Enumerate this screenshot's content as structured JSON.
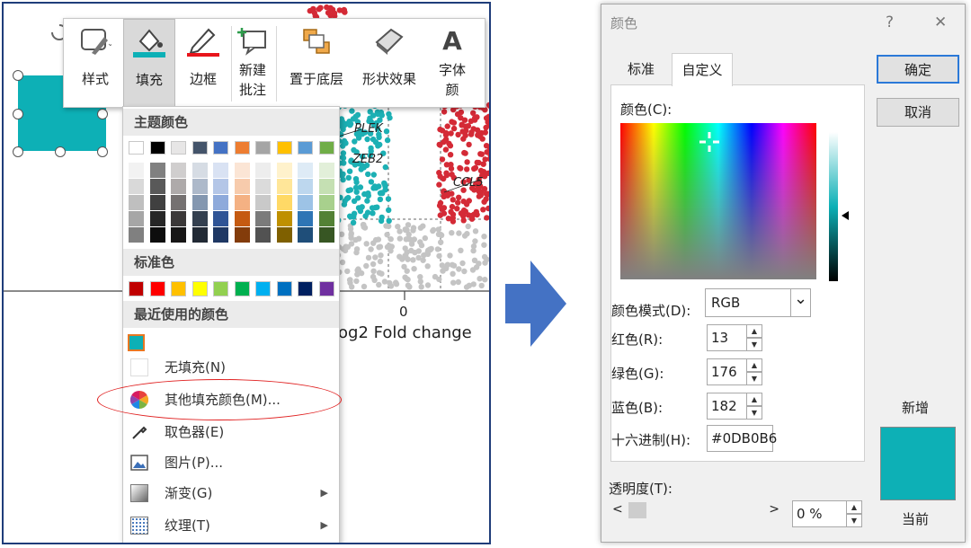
{
  "left_panel": {
    "background_chart": {
      "gene_labels": [
        "PLEK",
        "ZEB2",
        "CCL5"
      ],
      "axis_tick": "0",
      "axis_label": "og2 Fold change"
    },
    "shape_color": "#0DB0B6",
    "toolbar": {
      "items": [
        {
          "label": "样式",
          "icon": "style-shape-icon"
        },
        {
          "label": "填充",
          "icon": "paint-bucket-icon"
        },
        {
          "label": "边框",
          "icon": "pen-border-icon"
        },
        {
          "label": "新建\n批注",
          "icon": "new-comment-icon"
        },
        {
          "label": "置于底层",
          "icon": "send-to-back-icon"
        },
        {
          "label": "形状效果",
          "icon": "shape-effects-icon"
        },
        {
          "label": "字体\n颜",
          "icon": "font-color-icon"
        }
      ],
      "font_icon_glyph": "A"
    },
    "fill_menu": {
      "theme_colors_header": "主题颜色",
      "theme_colors_top": [
        "#FFFFFF",
        "#000000",
        "#E7E6E6",
        "#44546A",
        "#4472C4",
        "#ED7D31",
        "#A5A5A5",
        "#FFC000",
        "#5B9BD5",
        "#70AD47"
      ],
      "theme_tints": [
        [
          "#F2F2F2",
          "#D9D9D9",
          "#BFBFBF",
          "#A6A6A6",
          "#808080"
        ],
        [
          "#808080",
          "#595959",
          "#404040",
          "#262626",
          "#0D0D0D"
        ],
        [
          "#D0CECE",
          "#AEAAAA",
          "#757171",
          "#3B3838",
          "#171616"
        ],
        [
          "#D6DCE4",
          "#ADB9CA",
          "#8497B0",
          "#333F4F",
          "#222A35"
        ],
        [
          "#D9E2F3",
          "#B4C6E7",
          "#8EAADB",
          "#2F5496",
          "#1F3864"
        ],
        [
          "#FBE5D5",
          "#F7CBAC",
          "#F4B183",
          "#C55A11",
          "#833C0B"
        ],
        [
          "#EDEDED",
          "#DBDBDB",
          "#C9C9C9",
          "#7B7B7B",
          "#525252"
        ],
        [
          "#FFF2CC",
          "#FFE699",
          "#FFD966",
          "#BF9000",
          "#7F6000"
        ],
        [
          "#DEEBF6",
          "#BDD7EE",
          "#9DC3E6",
          "#2E75B5",
          "#1F4E79"
        ],
        [
          "#E2EFD9",
          "#C5E0B3",
          "#A8D08D",
          "#538135",
          "#375623"
        ]
      ],
      "standard_colors_header": "标准色",
      "standard_colors": [
        "#C00000",
        "#FF0000",
        "#FFC000",
        "#FFFF00",
        "#92D050",
        "#00B050",
        "#00B0F0",
        "#0070C0",
        "#002060",
        "#7030A0"
      ],
      "recent_colors_header": "最近使用的颜色",
      "recent_colors": [
        "#0DB0B6"
      ],
      "items": [
        {
          "label": "无填充(N)",
          "icon": "no-fill-icon",
          "submenu": false
        },
        {
          "label": "其他填充颜色(M)...",
          "icon": "color-wheel-icon",
          "submenu": false
        },
        {
          "label": "取色器(E)",
          "icon": "eyedropper-icon",
          "submenu": false
        },
        {
          "label": "图片(P)...",
          "icon": "picture-icon",
          "submenu": false
        },
        {
          "label": "渐变(G)",
          "icon": "gradient-icon",
          "submenu": true
        },
        {
          "label": "纹理(T)",
          "icon": "texture-icon",
          "submenu": true
        }
      ],
      "submenu_arrow": "▶"
    }
  },
  "arrow_color": "#4472C4",
  "dialog": {
    "title": "颜色",
    "help": "?",
    "close": "✕",
    "tabs": [
      "标准",
      "自定义"
    ],
    "active_tab": 1,
    "ok_label": "确定",
    "cancel_label": "取消",
    "colors_label": "颜色(C):",
    "color_model_label": "颜色模式(D):",
    "color_model_value": "RGB",
    "red_label": "红色(R):",
    "red_value": "13",
    "green_label": "绿色(G):",
    "green_value": "176",
    "blue_label": "蓝色(B):",
    "blue_value": "182",
    "hex_label": "十六进制(H):",
    "hex_value": "#0DB0B6",
    "transparency_label": "透明度(T):",
    "transparency_value": "0 %",
    "new_label": "新增",
    "current_label": "当前",
    "new_color": "#0DB0B6",
    "current_color": "#0DB0B6",
    "spin_up": "▲",
    "spin_down": "▼",
    "scroll_left": "<",
    "scroll_right": ">",
    "dropdown_glyph": "⌄"
  }
}
